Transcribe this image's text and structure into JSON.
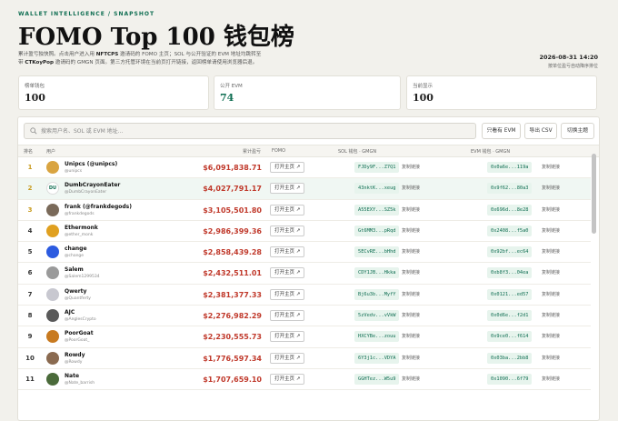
{
  "header": {
    "eyebrow": "WALLET INTELLIGENCE / SNAPSHOT",
    "title": "FOMO Top 100 钱包榜",
    "desc_1": "累计盈亏独快照。点击用户进入用 ",
    "desc_nft": "NFTCPS",
    "desc_2": " 邀请码的 FOMO 主页；SOL 与公开验证的 EVM 地址均跳转至",
    "desc_3": "带 ",
    "desc_ktk": "CTKoyPop",
    "desc_4": " 邀请码的 GMGN 页面。第三方托管环境在当前页打开链接，返回榜单请使用浏览器后退。",
    "timestamp": "2026-08-31 14:20",
    "timestamp_note": "按单位盈亏自动降序排位"
  },
  "stats": [
    {
      "label": "榜单钱包",
      "value": "100"
    },
    {
      "label": "公开 EVM",
      "value": "74"
    },
    {
      "label": "当前显示",
      "value": "100"
    }
  ],
  "toolbar": {
    "search_placeholder": "搜索用户名、SOL 或 EVM 地址...",
    "evm_only": "只看有 EVM",
    "export_csv": "导出 CSV",
    "toggle_theme": "切换主题"
  },
  "columns": {
    "rank": "排名",
    "user": "用户",
    "pnl": "累计盈亏",
    "fomo": "FOMO",
    "sol": "SOL 钱包 · GMGN",
    "evm": "EVM 钱包 · GMGN"
  },
  "common": {
    "open_home": "打开主页 ↗",
    "copy_link": "复制链接"
  },
  "rows": [
    {
      "rank": "1",
      "name": "Unipcs (@unipcs)",
      "handle": "@unipcs",
      "pnl": "$6,091,838.71",
      "sol": "FJDy9F...Z7Q1",
      "evm": "0x0a6e...119a",
      "avatar": "#d9a441"
    },
    {
      "rank": "2",
      "name": "DumbCrayonEater",
      "handle": "@DumbCrayonEater",
      "pnl": "$4,027,791.17",
      "sol": "43nktK...xeug",
      "evm": "0x9f62...80a3",
      "avatar": "DU"
    },
    {
      "rank": "3",
      "name": "frank (@frankdegods)",
      "handle": "@frankdegods",
      "pnl": "$3,105,501.80",
      "sol": "A55EXY...SZ5k",
      "evm": "0x696d...8e28",
      "avatar": "#7a6a5a"
    },
    {
      "rank": "4",
      "name": "Ethermonk",
      "handle": "@ether_monk",
      "pnl": "$2,986,399.36",
      "sol": "Gt6MM3...pRqd",
      "evm": "0x2408...f5a0",
      "avatar": "#e0a020"
    },
    {
      "rank": "5",
      "name": "change",
      "handle": "@change",
      "pnl": "$2,858,439.28",
      "sol": "5ECvRE...bHhd",
      "evm": "0x92bf...ec64",
      "avatar": "#2c5be0"
    },
    {
      "rank": "6",
      "name": "Salem",
      "handle": "@Salem1299534",
      "pnl": "$2,432,511.01",
      "sol": "CDY1JB...Hkka",
      "evm": "0xb8f3...04ea",
      "avatar": "#9a9a9a"
    },
    {
      "rank": "7",
      "name": "Qwerty",
      "handle": "@Quantferty",
      "pnl": "$2,381,377.33",
      "sol": "Bj6u3b...MyfY",
      "evm": "0x0121...ed57",
      "avatar": "#c8c8d0"
    },
    {
      "rank": "8",
      "name": "AJC",
      "handle": "@AnglesCrypto",
      "pnl": "$2,276,982.29",
      "sol": "5zVedv...vVkW",
      "evm": "0x0d6e...f2d1",
      "avatar": "#5a5a5a"
    },
    {
      "rank": "9",
      "name": "PoorGoat",
      "handle": "@PoorGoat_",
      "pnl": "$2,230,555.73",
      "sol": "HXCYBe...zouu",
      "evm": "0x9ce0...f614",
      "avatar": "#c87a20"
    },
    {
      "rank": "10",
      "name": "Rowdy",
      "handle": "@Rowdy",
      "pnl": "$1,776,597.34",
      "sol": "6Y3j1c...VDYA",
      "evm": "0x03ba...2bb8",
      "avatar": "#8a6a50"
    },
    {
      "rank": "11",
      "name": "Nate",
      "handle": "@Nate_barrish",
      "pnl": "$1,707,659.10",
      "sol": "GGHTez...W5u9",
      "evm": "0x1090...6f79",
      "avatar": "#4a6a3a"
    }
  ]
}
